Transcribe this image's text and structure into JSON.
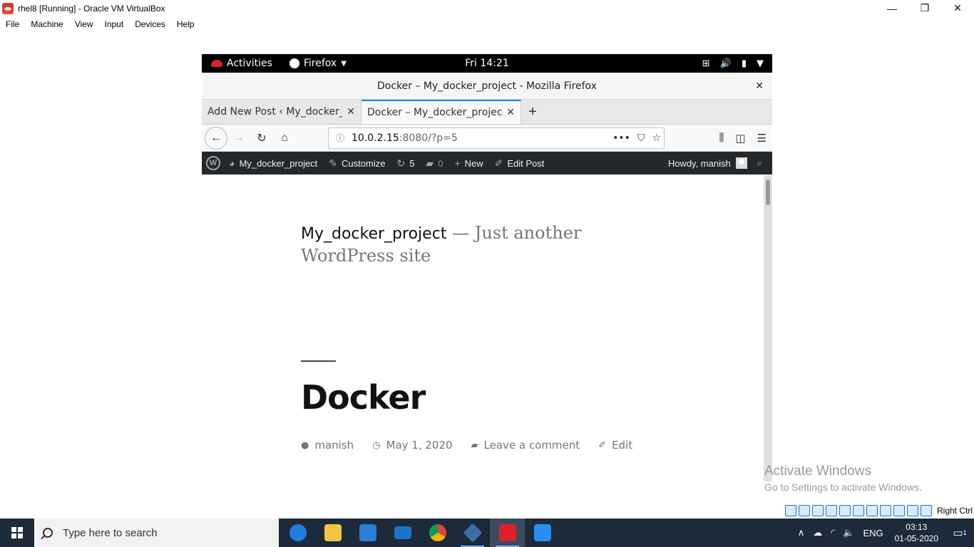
{
  "host_window": {
    "title": "rhel8 [Running] - Oracle VM VirtualBox",
    "controls": {
      "minimize": "—",
      "restore": "❐",
      "close": "✕"
    },
    "menu": [
      "File",
      "Machine",
      "View",
      "Input",
      "Devices",
      "Help"
    ]
  },
  "gnome": {
    "activities": "Activities",
    "app_menu": "Firefox",
    "clock": "Fri 14:21",
    "status_icons": [
      "network-icon",
      "volume-icon",
      "battery-icon",
      "menu-caret-icon"
    ]
  },
  "firefox": {
    "window_title": "Docker – My_docker_project - Mozilla Firefox",
    "tabs": [
      {
        "label": "Add New Post ‹ My_docker_project",
        "active": false
      },
      {
        "label": "Docker – My_docker_project",
        "active": true
      }
    ],
    "url_host": "10.0.2.15",
    "url_path": ":8080/?p=5"
  },
  "wp_admin_bar": {
    "site": "My_docker_project",
    "customize": "Customize",
    "updates": "5",
    "comments": "0",
    "new": "New",
    "edit_post": "Edit Post",
    "howdy": "Howdy, manish"
  },
  "page": {
    "site_name": "My_docker_project",
    "separator": "—",
    "tagline": "Just another WordPress site",
    "post_title": "Docker",
    "meta": {
      "author": "manish",
      "date": "May 1, 2020",
      "comments": "Leave a comment",
      "edit": "Edit"
    }
  },
  "watermark": {
    "title": "Activate Windows",
    "subtitle": "Go to Settings to activate Windows."
  },
  "vb_status": {
    "host_key": "Right Ctrl"
  },
  "taskbar": {
    "search_placeholder": "Type here to search",
    "apps": [
      "edge",
      "file-explorer",
      "store",
      "mail",
      "chrome",
      "virtualbox",
      "rhel-vm",
      "sync-app"
    ],
    "language": "ENG",
    "time": "03:13",
    "date": "01-05-2020",
    "notification_count": "1"
  }
}
